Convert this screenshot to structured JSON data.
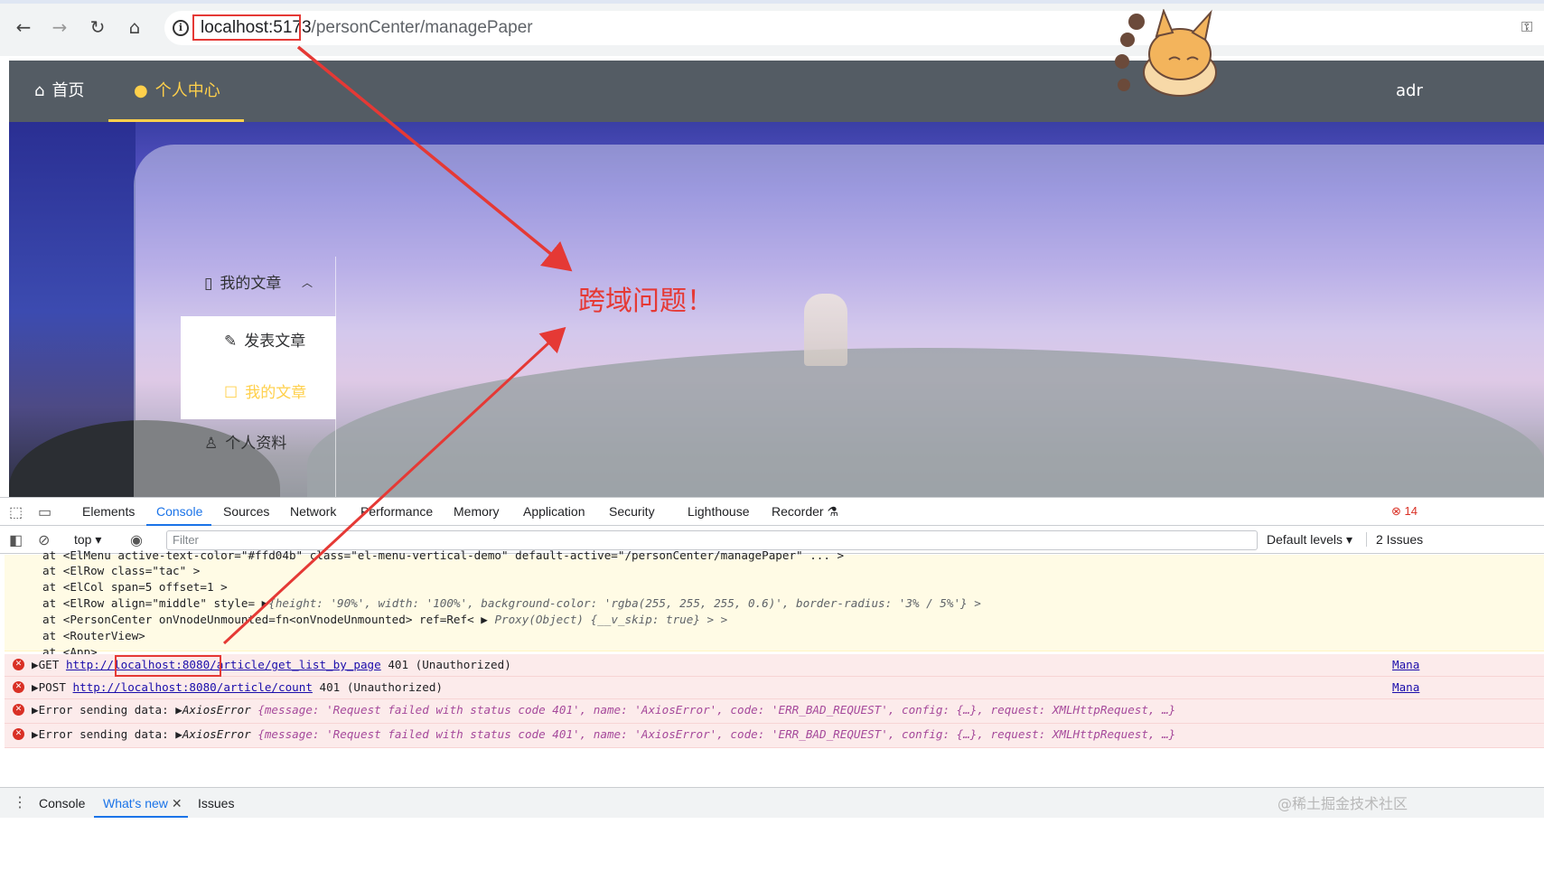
{
  "browser": {
    "url_host": "localhost:5173",
    "url_path": "/personCenter/managePaper",
    "back_icon": "arrow-left-icon",
    "forward_icon": "arrow-right-icon",
    "reload_icon": "reload-icon",
    "home_icon": "home-icon",
    "info_icon": "info-icon",
    "info_glyph": "i",
    "key_icon": "key-icon"
  },
  "app_nav": {
    "items": [
      {
        "label": "首页",
        "icon": "home-icon"
      },
      {
        "label": "个人中心",
        "icon": "user-icon"
      }
    ],
    "user_label": "adr",
    "active_color": "#ffd04b",
    "background": "#545c64"
  },
  "side_menu": {
    "group_label": "我的文章",
    "group_icon": "book-icon",
    "sub_items": [
      {
        "label": "发表文章",
        "icon": "edit-pen-icon"
      },
      {
        "label": "我的文章",
        "icon": "edit-square-icon"
      }
    ],
    "profile_label": "个人资料",
    "profile_icon": "user-icon"
  },
  "annotation": {
    "label": "跨域问题！",
    "color": "#e53935"
  },
  "devtools": {
    "tabs": [
      "Elements",
      "Console",
      "Sources",
      "Network",
      "Performance",
      "Memory",
      "Application",
      "Security",
      "Lighthouse",
      "Recorder"
    ],
    "active_tab": "Console",
    "error_count": "14",
    "toolbar": {
      "context": "top",
      "filter_placeholder": "Filter",
      "levels": "Default levels",
      "issues": "2 Issues"
    },
    "warning_trace": [
      "at <ElMenu active-text-color=\"#ffd04b\" class=\"el-menu-vertical-demo\" default-active=\"/personCenter/managePaper\" ... >",
      "at <ElRow class=\"tac\" >",
      "at <ElCol span=5 offset=1 >",
      "at <ElRow align=\"middle\" style= ",
      "at <PersonCenter onVnodeUnmounted=fn<onVnodeUnmounted> ref=Ref< ",
      "at <RouterView>",
      "at <App>"
    ],
    "trace_style_obj": "{height: '90%', width: '100%', background-color: 'rgba(255, 255, 255, 0.6)', border-radius: '3% / 5%'} >",
    "trace_proxy_obj": "Proxy(Object) {__v_skip: true} > >",
    "errors": [
      {
        "method": "GET",
        "url": "http://localhost:8080/article/get_list_by_page",
        "status": "401 (Unauthorized)",
        "source": "Mana"
      },
      {
        "method": "POST",
        "url": "http://localhost:8080/article/count",
        "status": "401 (Unauthorized)",
        "source": "Mana"
      },
      {
        "prefix": "Error sending data:",
        "type": "AxiosError",
        "body": "{message: 'Request failed with status code 401', name: 'AxiosError', code: 'ERR_BAD_REQUEST', config: {…}, request: XMLHttpRequest, …}"
      },
      {
        "prefix": "Error sending data:",
        "type": "AxiosError",
        "body": "{message: 'Request failed with status code 401', name: 'AxiosError', code: 'ERR_BAD_REQUEST', config: {…}, request: XMLHttpRequest, …}"
      }
    ],
    "drawer_tabs": [
      "Console",
      "What's new",
      "Issues"
    ],
    "drawer_active": "What's new"
  },
  "watermark": "@稀土掘金技术社区"
}
